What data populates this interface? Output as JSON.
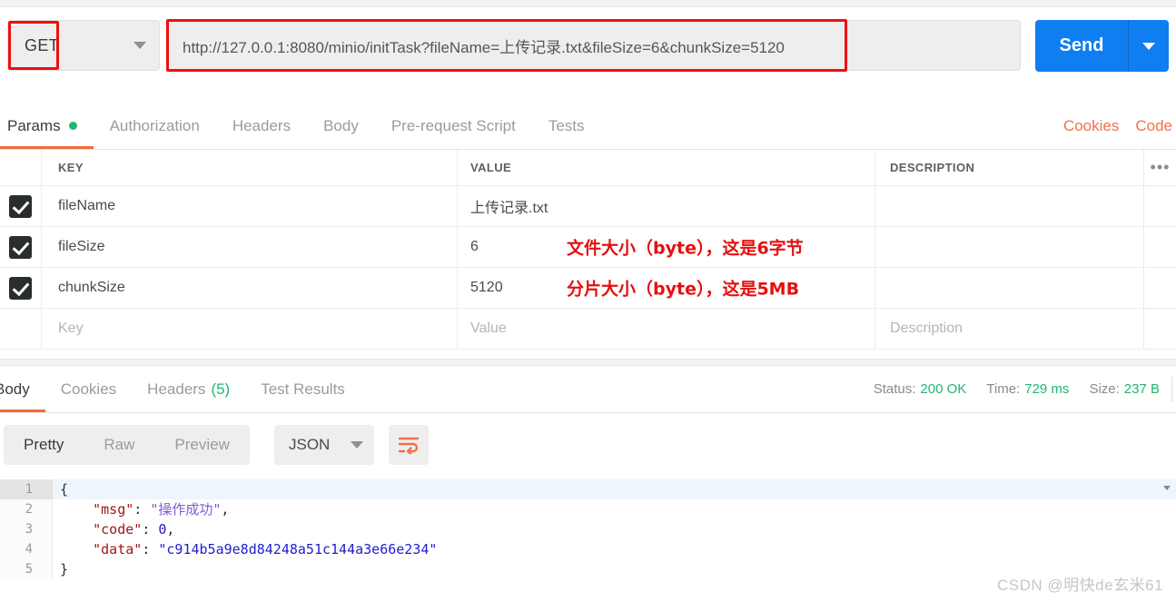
{
  "request": {
    "method": "GET",
    "url": "http://127.0.0.1:8080/minio/initTask?fileName=上传记录.txt&fileSize=6&chunkSize=5120",
    "send_label": "Send",
    "method_caret_icon": "chevron-down-icon",
    "send_caret_icon": "chevron-down-icon"
  },
  "request_tabs": [
    {
      "label": "Params",
      "active": true,
      "has_dot": true
    },
    {
      "label": "Authorization",
      "active": false,
      "has_dot": false
    },
    {
      "label": "Headers",
      "active": false,
      "has_dot": false
    },
    {
      "label": "Body",
      "active": false,
      "has_dot": false
    },
    {
      "label": "Pre-request Script",
      "active": false,
      "has_dot": false
    },
    {
      "label": "Tests",
      "active": false,
      "has_dot": false
    }
  ],
  "tabs_right": {
    "cookies": "Cookies",
    "code": "Code"
  },
  "params_table": {
    "headers": {
      "key": "KEY",
      "value": "VALUE",
      "description": "DESCRIPTION",
      "more_icon": "ellipsis-icon"
    },
    "rows": [
      {
        "checked": true,
        "key": "fileName",
        "value": "上传记录.txt",
        "description": "",
        "annotation": ""
      },
      {
        "checked": true,
        "key": "fileSize",
        "value": "6",
        "description": "",
        "annotation": "文件大小（byte），这是6字节"
      },
      {
        "checked": true,
        "key": "chunkSize",
        "value": "5120",
        "description": "",
        "annotation": "分片大小（byte），这是5MB"
      }
    ],
    "empty_row": {
      "key": "Key",
      "value": "Value",
      "description": "Description"
    }
  },
  "response_tabs": [
    {
      "label": "Body",
      "active": true,
      "count": ""
    },
    {
      "label": "Cookies",
      "active": false,
      "count": ""
    },
    {
      "label": "Headers",
      "active": false,
      "count": "(5)"
    },
    {
      "label": "Test Results",
      "active": false,
      "count": ""
    }
  ],
  "response_meta": {
    "status_label": "Status:",
    "status_value": "200 OK",
    "time_label": "Time:",
    "time_value": "729 ms",
    "size_label": "Size:",
    "size_value": "237 B"
  },
  "format_bar": {
    "pretty": "Pretty",
    "raw": "Raw",
    "preview": "Preview",
    "language": "JSON",
    "language_caret_icon": "chevron-down-icon",
    "wrap_icon": "word-wrap-icon"
  },
  "response_body": {
    "lines": [
      {
        "n": "1",
        "foldable": true,
        "open": "{",
        "key": "",
        "colon": "",
        "value": "",
        "comma": ""
      },
      {
        "n": "2",
        "foldable": false,
        "open": "",
        "key": "\"msg\"",
        "colon": ": ",
        "value": "\"操作成功\"",
        "comma": ",",
        "value_type": "cjk"
      },
      {
        "n": "3",
        "foldable": false,
        "open": "",
        "key": "\"code\"",
        "colon": ": ",
        "value": "0",
        "comma": ",",
        "value_type": "num"
      },
      {
        "n": "4",
        "foldable": false,
        "open": "",
        "key": "\"data\"",
        "colon": ": ",
        "value": "\"c914b5a9e8d84248a51c144a3e66e234\"",
        "comma": "",
        "value_type": "str"
      },
      {
        "n": "5",
        "foldable": false,
        "open": "}",
        "key": "",
        "colon": "",
        "value": "",
        "comma": ""
      }
    ]
  },
  "watermark": "CSDN @明快de玄米61",
  "colors": {
    "accent_orange": "#f26b3a",
    "send_blue": "#0f7ef0",
    "status_green": "#22b573",
    "annotation_red": "#e60f0f",
    "highlight_red": "#ef0f0f"
  }
}
